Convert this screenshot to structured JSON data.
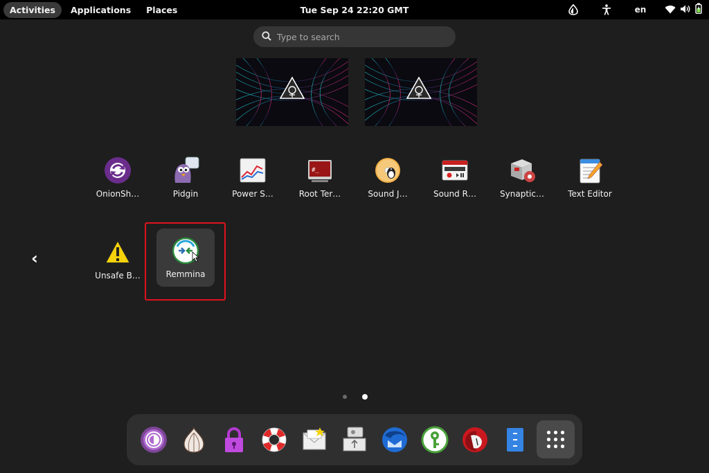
{
  "topbar": {
    "activities": "Activities",
    "applications": "Applications",
    "places": "Places",
    "clock": "Tue Sep 24  22:20 GMT",
    "language": "en",
    "icons": [
      "tor-onion-status-icon",
      "accessibility-icon",
      "wifi-icon",
      "volume-icon",
      "battery-icon"
    ]
  },
  "search": {
    "placeholder": "Type to search"
  },
  "workspaces": [
    "workspace-1",
    "workspace-2"
  ],
  "apps_row1": [
    {
      "label": "OnionSh…",
      "icon": "onionshare-icon"
    },
    {
      "label": "Pidgin",
      "icon": "pidgin-icon"
    },
    {
      "label": "Power S…",
      "icon": "power-statistics-icon"
    },
    {
      "label": "Root Ter…",
      "icon": "root-terminal-icon"
    },
    {
      "label": "Sound J…",
      "icon": "sound-juicer-icon"
    },
    {
      "label": "Sound R…",
      "icon": "sound-recorder-icon"
    },
    {
      "label": "Synaptic…",
      "icon": "synaptic-icon"
    },
    {
      "label": "Text Editor",
      "icon": "text-editor-icon"
    }
  ],
  "apps_row2": [
    {
      "label": "Unsafe B…",
      "icon": "unsafe-browser-icon"
    },
    {
      "label": "Remmina",
      "icon": "remmina-icon",
      "selected": true
    }
  ],
  "pagination": {
    "pages": 2,
    "current": 2
  },
  "dock": [
    {
      "icon": "tor-browser-icon"
    },
    {
      "icon": "onion-circuits-icon"
    },
    {
      "icon": "keepassxc-lock-icon"
    },
    {
      "icon": "help-lifebuoy-icon"
    },
    {
      "icon": "mail-icon"
    },
    {
      "icon": "persistent-storage-icon"
    },
    {
      "icon": "thunderbird-icon"
    },
    {
      "icon": "keepassxc-icon"
    },
    {
      "icon": "unsafe-browser-dock-icon"
    },
    {
      "icon": "files-icon"
    },
    {
      "icon": "show-apps-icon"
    }
  ],
  "colors": {
    "highlight": "#e0121d",
    "panel": "#000000",
    "background": "#1e1e1e"
  }
}
